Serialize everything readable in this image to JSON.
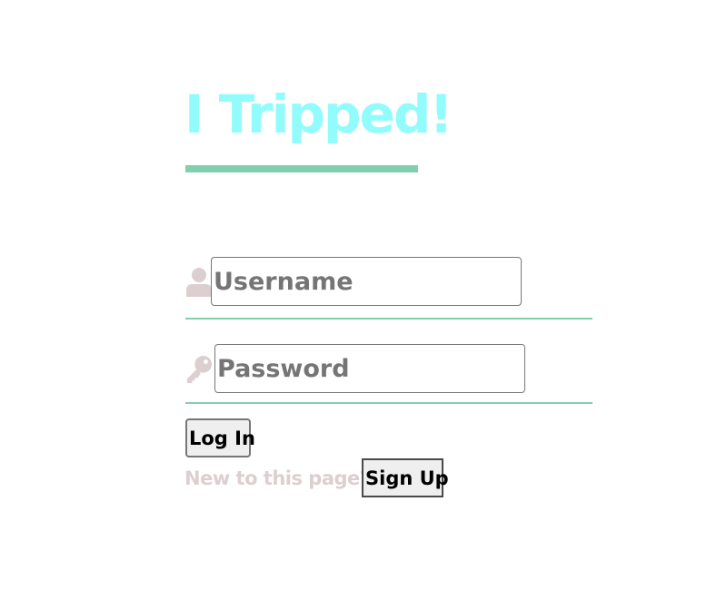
{
  "app": {
    "title": "I Tripped!"
  },
  "login_form": {
    "username": {
      "placeholder": "Username",
      "value": "",
      "icon": "user-icon"
    },
    "password": {
      "placeholder": "Password",
      "value": "",
      "icon": "key-icon"
    },
    "login_label": "Log In",
    "signup_prompt": "New to this page?",
    "signup_label": "Sign Up"
  },
  "colors": {
    "title": "#92fcfc",
    "accent_line": "#82cfad",
    "icon": "#dccfcf",
    "muted_text": "#dccfcf"
  }
}
